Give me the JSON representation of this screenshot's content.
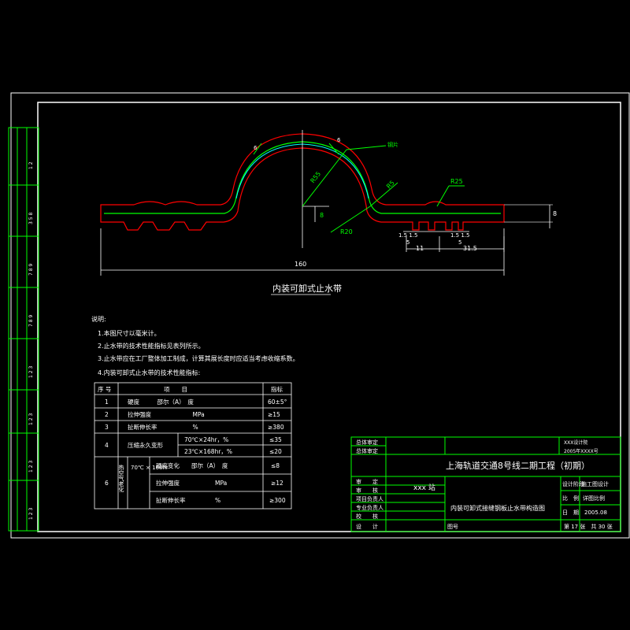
{
  "drawing": {
    "caption": "内装可卸式止水带",
    "dims": {
      "total_length": "160",
      "radius_outer": "R55",
      "radius_mid": "R5",
      "radius_small": "R25",
      "r20": "R20",
      "h8": "8",
      "seg1": "11",
      "seg2": "31.5",
      "thick": "8",
      "small_a": "1.5 1.5",
      "small_b": "1.5 1.5",
      "five_a": "5",
      "five_b": "5",
      "leader_label": "钢片",
      "phi_a": "6",
      "phi_b": "6"
    }
  },
  "notes": {
    "heading": "说明:",
    "lines": [
      "1.本图尺寸以毫米计。",
      "2.止水带的技术性能指标见表列所示。",
      "3.止水带应在工厂整体加工制成，计算其展长度时应适当考虑收缩系数。",
      "4.内装可卸式止水带的技术性能指标:"
    ]
  },
  "spec_table": {
    "headers": [
      "序 号",
      "项　　目",
      "指标"
    ],
    "rows": [
      {
        "no": "1",
        "item": "硬度　　　邵尔（A）　度",
        "value": "60±5°"
      },
      {
        "no": "2",
        "item": "拉伸强度　　　　　　　MPa",
        "value": "≥15"
      },
      {
        "no": "3",
        "item": "扯断伸长率　　　　　　%",
        "value": "≥380"
      }
    ],
    "row4": {
      "no": "4",
      "item": "压缩永久变形",
      "sub": [
        {
          "cond": "70℃×24hr，%",
          "value": "≤35"
        },
        {
          "cond": "23℃×168hr，%",
          "value": "≤20"
        }
      ]
    },
    "row6": {
      "no": "6",
      "item": "热空气老化",
      "cond": "70℃ × 168hr",
      "sub": [
        {
          "name": "硬度变化　　邵尔（A）　度",
          "value": "≤8"
        },
        {
          "name": "拉伸强度　　　　　　MPa",
          "value": "≥12"
        },
        {
          "name": "扯断伸长率　　　　　%",
          "value": "≥300"
        }
      ]
    }
  },
  "title_block": {
    "project": "上海轨道交通8号线二期工程（初期）",
    "station": "xxx 站",
    "drawing_title": "内装可卸式接缝钢板止水带构造图",
    "left_rows": [
      "审　　定",
      "审　　核",
      "项目负责人",
      "专业负责人",
      "校　　核",
      "设　　计"
    ],
    "top_rows": [
      "总体审定",
      "总体审定"
    ],
    "design_stage_label": "设计阶段",
    "design_stage": "施工图设计",
    "scale_label": "比　例",
    "scale": "详图比例",
    "date_label": "日　期",
    "date": "2005.08",
    "sheet": "第 17 张　共 30 张",
    "drawing_no_label": "图号",
    "code_top": "XXX设计院",
    "code_bottom": "2005年XXXX号"
  },
  "side_strip": {
    "labels": [
      "1 2",
      "3 5 8",
      "7 8 9",
      "7 8 9",
      "1 2 3",
      "1 2 3",
      "1 2 3",
      "1 2 3"
    ]
  }
}
